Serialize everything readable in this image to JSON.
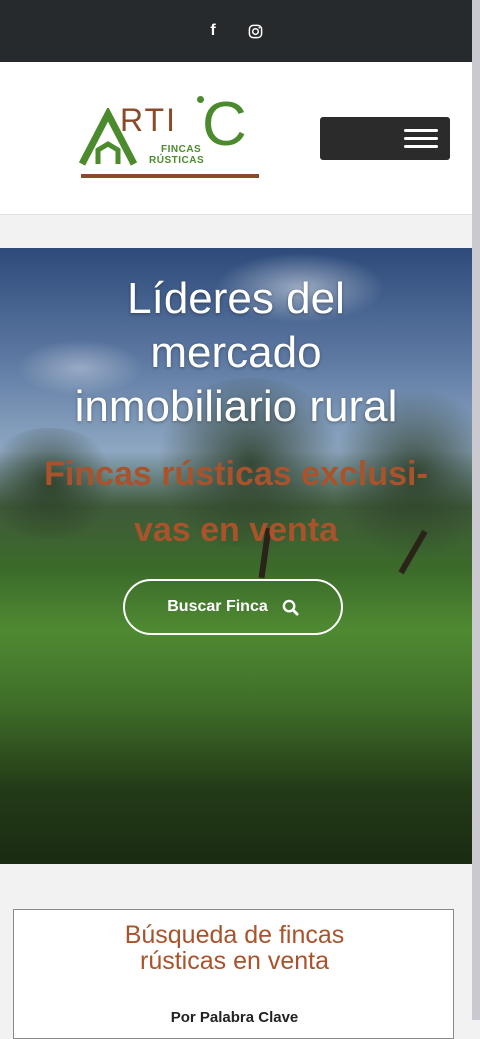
{
  "topbar": {
    "social": [
      {
        "icon": "facebook-icon",
        "glyph": "f"
      },
      {
        "icon": "instagram-icon"
      }
    ]
  },
  "header": {
    "logo": {
      "letters": "RTI",
      "big_letter": "C",
      "line1": "FINCAS",
      "line2": "RÚSTICAS"
    },
    "menu_icon": "hamburger-icon"
  },
  "hero": {
    "title_lines": [
      "Líderes del",
      "mercado",
      "inmobiliario rural"
    ],
    "subtitle_lines": [
      "Fincas rústicas exclusi-",
      "vas en venta"
    ],
    "cta_label": "Buscar Finca",
    "cta_icon": "search-icon"
  },
  "search_section": {
    "title_lines": [
      "Búsqueda de fincas",
      "rústicas en venta"
    ],
    "keyword_label": "Por Palabra Clave"
  },
  "colors": {
    "topbar": "#272a2c",
    "brand_green": "#4c8a2e",
    "brand_brown": "#8a4a2a",
    "accent_text": "#a8532c"
  }
}
